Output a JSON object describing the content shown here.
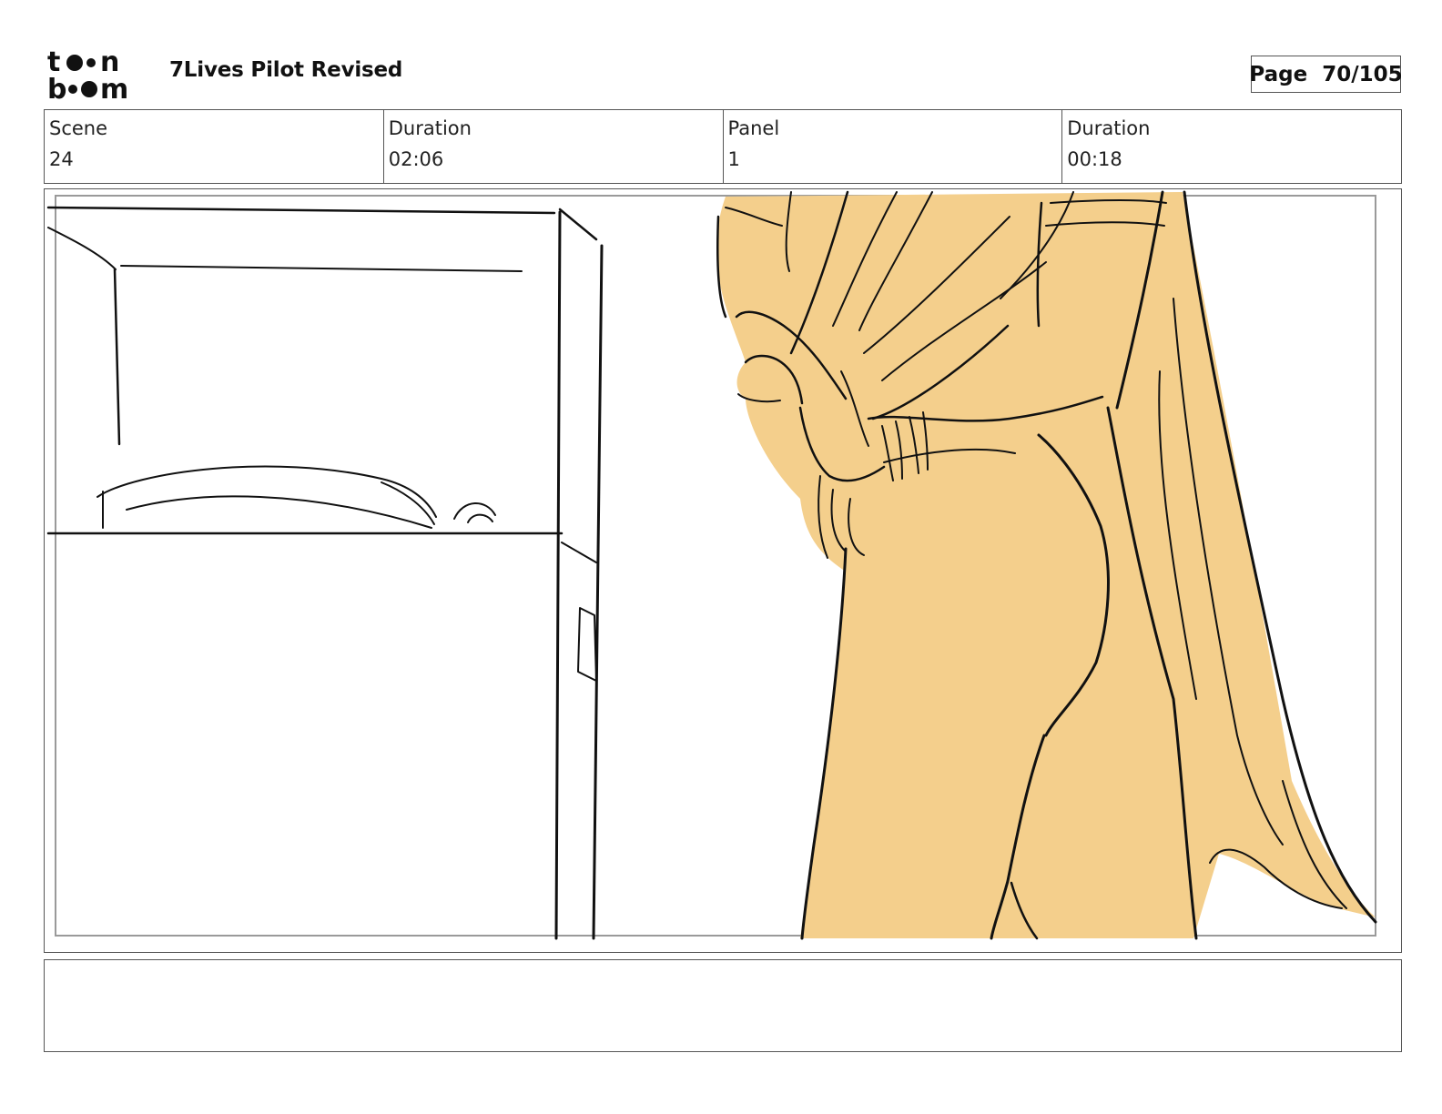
{
  "header": {
    "brand": "toon boom",
    "title": "7Lives Pilot Revised",
    "page_label": "Page",
    "page_number": "70/105"
  },
  "info": {
    "scene_label": "Scene",
    "scene_value": "24",
    "scene_duration_label": "Duration",
    "scene_duration_value": "02:06",
    "panel_label": "Panel",
    "panel_value": "1",
    "panel_duration_label": "Duration",
    "panel_duration_value": "00:18"
  },
  "colors": {
    "figure_fill": "#f4cf8c",
    "ink": "#111111",
    "frame_border": "#555555"
  },
  "notes": {
    "text": ""
  }
}
